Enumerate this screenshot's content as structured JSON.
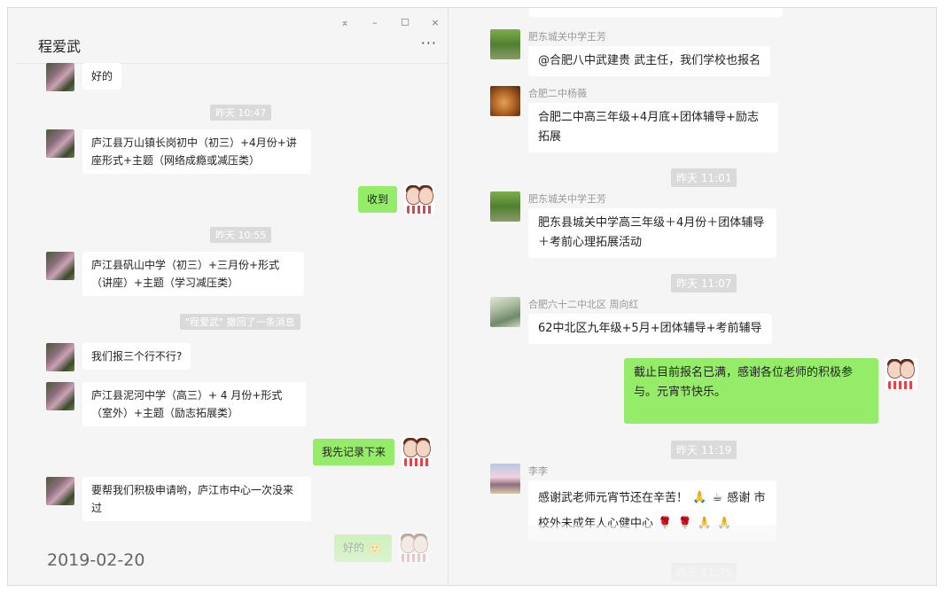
{
  "left": {
    "window_controls": {
      "pin": "⌅",
      "minimize": "–",
      "maximize": "☐",
      "close": "×"
    },
    "title": "程爱武",
    "more_label": "···",
    "messages": [
      {
        "text": "好的"
      },
      {
        "time": "昨天 10:47"
      },
      {
        "text": "庐江县万山镇长岗初中（初三）+4月份+讲座形式+主题（网络成瘾或减压类）"
      },
      {
        "text": "收到",
        "self": true
      },
      {
        "time": "昨天 10:55"
      },
      {
        "text": "庐江县矾山中学（初三）+三月份+形式（讲座）+主题（学习减压类）"
      },
      {
        "recall": "\"程爱武\" 撤回了一条消息"
      },
      {
        "text": "我们报三个行不行?"
      },
      {
        "text": "庐江县泥河中学（高三）+ 4 月份+形式（室外）+主题（励志拓展类）"
      },
      {
        "text": "我先记录下来",
        "self": true
      },
      {
        "text": "要帮我们积极申请哟，庐江市中心一次没来过"
      },
      {
        "text": "好的",
        "self": true,
        "emoji": "🙂"
      }
    ],
    "date_overlay": "2019-02-20"
  },
  "right": {
    "messages": [
      {
        "sender": "肥东城关中学王芳",
        "text": "@合肥八中武建贵 武主任，我们学校也报名"
      },
      {
        "sender": "合肥二中杨薇",
        "text": "合肥二中高三年级+4月底+团体辅导+励志拓展"
      },
      {
        "time": "昨天 11:01"
      },
      {
        "sender": "肥东城关中学王芳",
        "text": "肥东县城关中学高三年级＋4月份＋团体辅导＋考前心理拓展活动"
      },
      {
        "time": "昨天 11:07"
      },
      {
        "sender": "合肥六十二中北区 周向红",
        "text": "62中北区九年级+5月+团体辅导+考前辅导"
      },
      {
        "text": "截止目前报名已满，感谢各位老师的积极参与。元宵节快乐。",
        "self": true
      },
      {
        "time": "昨天 11:19"
      },
      {
        "sender": "李李",
        "text_a": "感谢武老师元宵节还在辛苦！",
        "text_b": "感谢",
        "text_c": "市校外未成年人心健中心",
        "emoji_hands": "🙏",
        "emoji_coffee": "☕",
        "emoji_rose": "🌹"
      },
      {
        "time": "昨天 11:35"
      }
    ]
  },
  "colors": {
    "self_bubble": "#95ec69",
    "other_bubble": "#ffffff",
    "background": "#f5f5f5",
    "timestamp_bg": "#dadada"
  }
}
